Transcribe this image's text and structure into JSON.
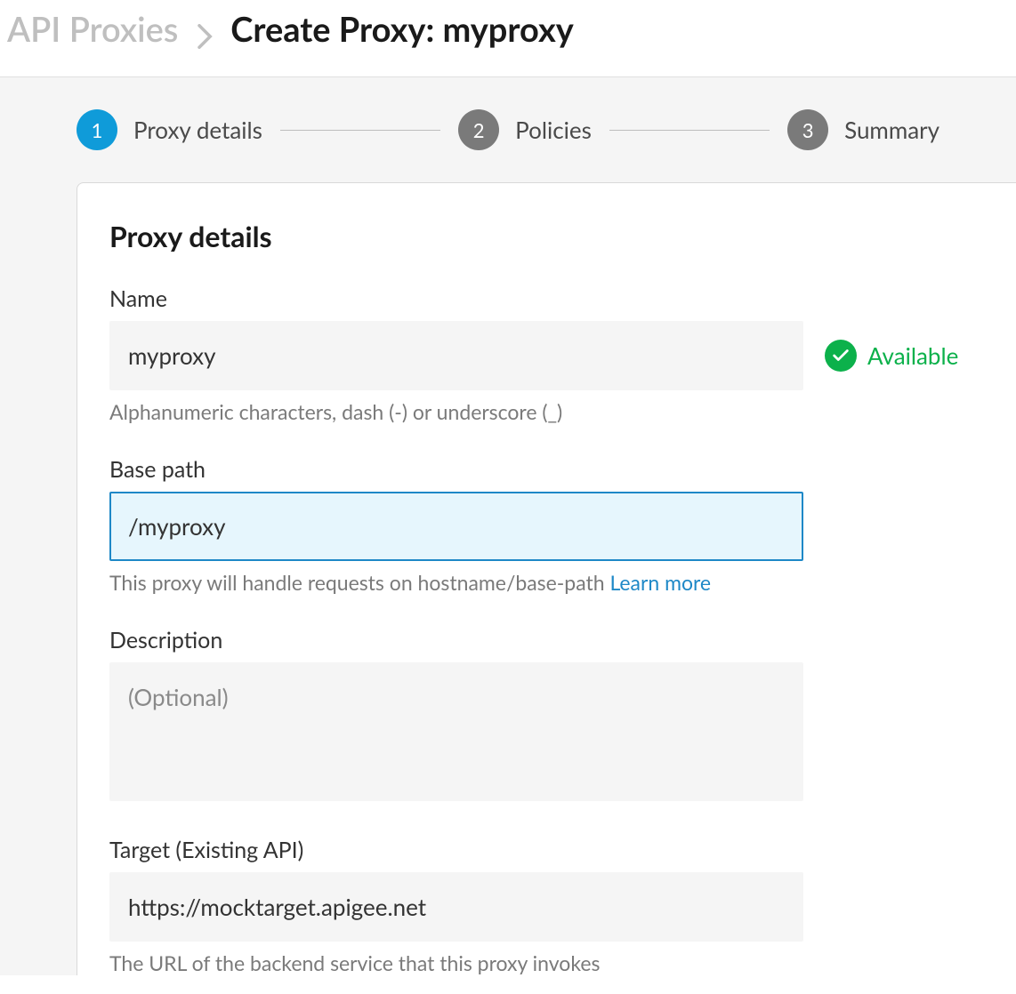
{
  "breadcrumb": {
    "parent": "API Proxies",
    "current": "Create Proxy: myproxy"
  },
  "stepper": {
    "steps": [
      {
        "num": "1",
        "label": "Proxy details",
        "active": true
      },
      {
        "num": "2",
        "label": "Policies",
        "active": false
      },
      {
        "num": "3",
        "label": "Summary",
        "active": false
      }
    ]
  },
  "card": {
    "title": "Proxy details",
    "fields": {
      "name": {
        "label": "Name",
        "value": "myproxy",
        "helper": "Alphanumeric characters, dash (-) or underscore (_)",
        "status": "Available"
      },
      "basepath": {
        "label": "Base path",
        "value": "/myproxy",
        "helper": "This proxy will handle requests on hostname/base-path ",
        "learn_more": "Learn more"
      },
      "description": {
        "label": "Description",
        "placeholder": "(Optional)",
        "value": ""
      },
      "target": {
        "label": "Target (Existing API)",
        "value": "https://mocktarget.apigee.net",
        "helper": "The URL of the backend service that this proxy invokes"
      }
    }
  }
}
